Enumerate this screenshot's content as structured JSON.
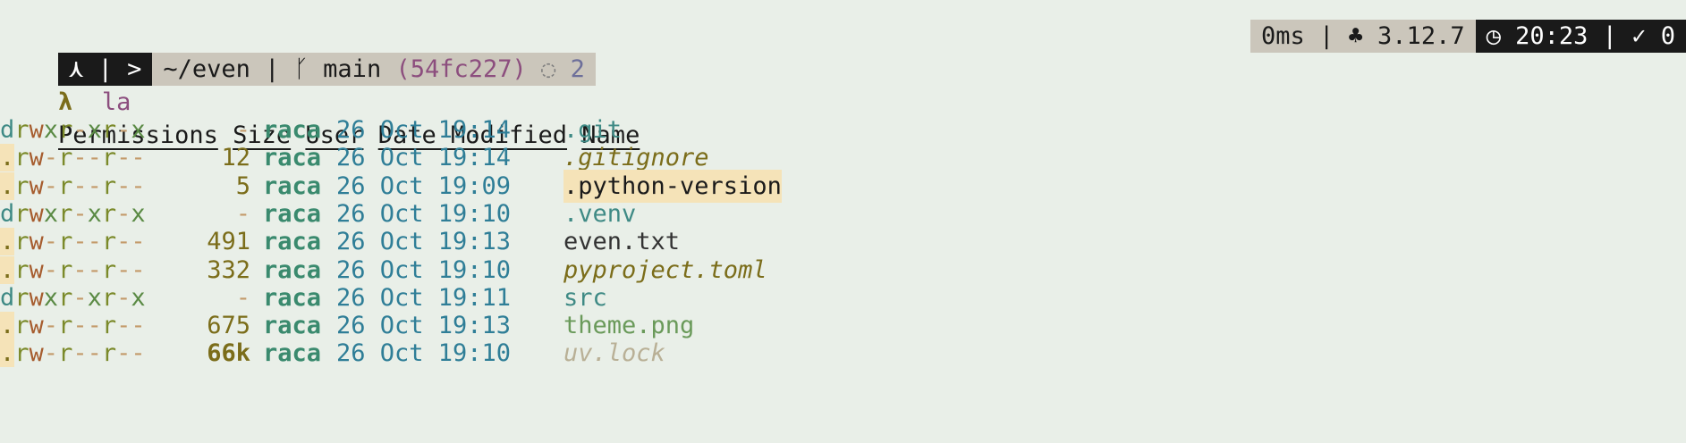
{
  "prompt": {
    "mode_icon": "⋏",
    "sep1": "|",
    "arrow": ">",
    "path": "~/even",
    "sep2": "|",
    "branch_icon": "git-branch-icon",
    "branch_glyph": "ᚴ",
    "branch": "main",
    "hash": "(54fc227)",
    "status_glyph": "◌",
    "status_count": "2"
  },
  "right_status": {
    "duration": "0ms",
    "sep": "|",
    "python_glyph": "♣",
    "python_version": "3.12.7",
    "clock_glyph": "◷",
    "time": "20:23",
    "sep2": "|",
    "check_glyph": "✓",
    "exit_code": "0"
  },
  "command": {
    "lambda": "λ",
    "text": "la"
  },
  "headers": {
    "permissions": "Permissions",
    "size": "Size",
    "user": "User",
    "date": "Date Modified",
    "name": "Name"
  },
  "rows": [
    {
      "perm": "drwxr-xr-x",
      "size": "-",
      "user": "raca",
      "date": "26 Oct 19:14",
      "name": ".git",
      "kind": "dir"
    },
    {
      "perm": ".rw-r--r--",
      "size": "12",
      "user": "raca",
      "date": "26 Oct 19:14",
      "name": ".gitignore",
      "kind": "ignore"
    },
    {
      "perm": ".rw-r--r--",
      "size": "5",
      "user": "raca",
      "date": "26 Oct 19:09",
      "name": ".python-version",
      "kind": "hl"
    },
    {
      "perm": "drwxr-xr-x",
      "size": "-",
      "user": "raca",
      "date": "26 Oct 19:10",
      "name": ".venv",
      "kind": "dir"
    },
    {
      "perm": ".rw-r--r--",
      "size": "491",
      "user": "raca",
      "date": "26 Oct 19:13",
      "name": "even.txt",
      "kind": "plain"
    },
    {
      "perm": ".rw-r--r--",
      "size": "332",
      "user": "raca",
      "date": "26 Oct 19:10",
      "name": "pyproject.toml",
      "kind": "toml"
    },
    {
      "perm": "drwxr-xr-x",
      "size": "-",
      "user": "raca",
      "date": "26 Oct 19:11",
      "name": "src",
      "kind": "dir"
    },
    {
      "perm": ".rw-r--r--",
      "size": "675",
      "user": "raca",
      "date": "26 Oct 19:13",
      "name": "theme.png",
      "kind": "png"
    },
    {
      "perm": ".rw-r--r--",
      "size": "66k",
      "user": "raca",
      "date": "26 Oct 19:10",
      "name": "uv.lock",
      "kind": "lock"
    }
  ]
}
